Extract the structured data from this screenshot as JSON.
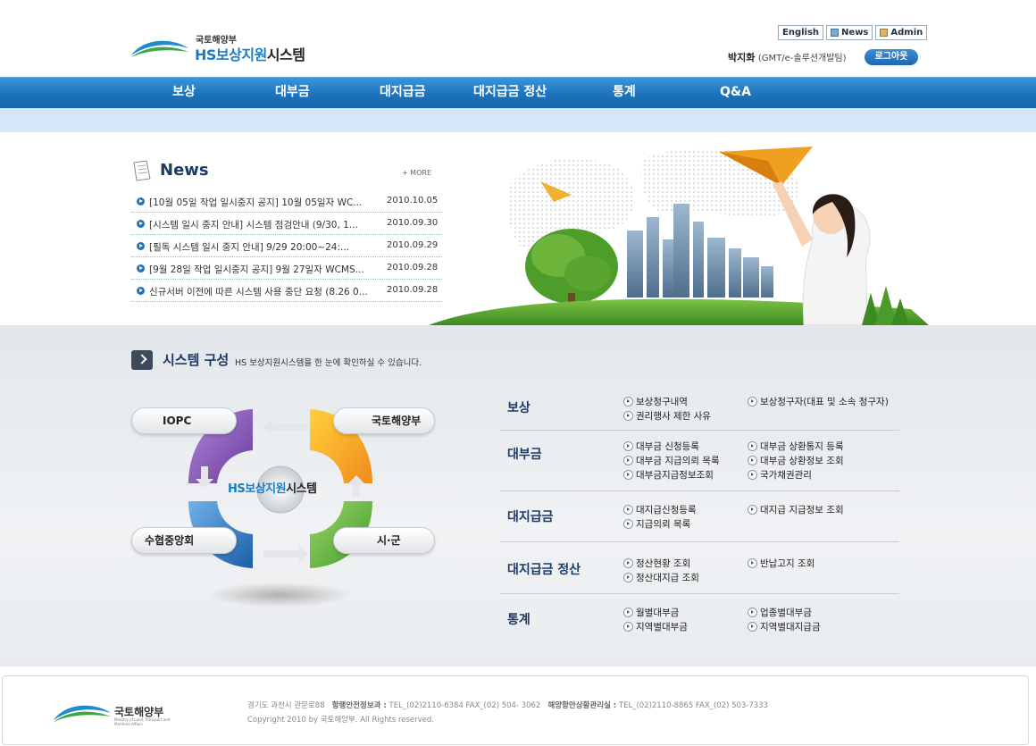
{
  "header": {
    "ministry": "국토해양부",
    "app_title_brand": "HS보상지원",
    "app_title_suffix": "시스템",
    "links": {
      "english": "English",
      "news": "News",
      "admin": "Admin"
    },
    "user_name": "박지화",
    "user_affiliation": "(GMT/e-솔루션개발팀)",
    "logout_label": "로그아웃"
  },
  "nav": {
    "items": [
      {
        "label": "보상"
      },
      {
        "label": "대부금"
      },
      {
        "label": "대지급금"
      },
      {
        "label": "대지급금 정산"
      },
      {
        "label": "통계"
      },
      {
        "label": "Q&A"
      }
    ]
  },
  "news": {
    "title": "News",
    "more": "+ MORE",
    "items": [
      {
        "title": "[10월 05일 작업 일시중지 공지] 10월 05일자 WC...",
        "date": "2010.10.05"
      },
      {
        "title": "[시스템 일시 중지 안내] 시스템 점검안내 (9/30, 1...",
        "date": "2010.09.30"
      },
      {
        "title": "[필독 시스템 일시 중지 안내] 9/29 20:00~24:...",
        "date": "2010.09.29"
      },
      {
        "title": "[9월 28일 작업 일시중지 공지] 9월 27일자 WCMS...",
        "date": "2010.09.28"
      },
      {
        "title": "신규서버 이전에 따른 시스템 사용 중단 요청 (8.26 0...",
        "date": "2010.09.28"
      }
    ]
  },
  "system": {
    "title": "시스템 구성",
    "desc": "HS 보상지원시스템을 한 눈에 확인하실 수 있습니다.",
    "diagram": {
      "center_brand": "HS보상지원",
      "center_suffix": "시스템",
      "nodes": {
        "top_left": "IOPC",
        "top_right": "국토해양부",
        "bottom_left": "수협중앙회",
        "bottom_right": "시·군"
      }
    }
  },
  "menu": {
    "categories": [
      {
        "name": "보상",
        "links": [
          "보상청구내역",
          "보상청구자(대표 및 소속 청구자)",
          "권리행사 제한 사유"
        ]
      },
      {
        "name": "대부금",
        "links": [
          "대부금 신청등록",
          "대부금 상환통지 등록",
          "대부금 지급의뢰 목록",
          "대부금 상환정보 조회",
          "대부금지급정보조회",
          "국가채권관리"
        ]
      },
      {
        "name": "대지급금",
        "links": [
          "대지급신청등록",
          "대지급 지급정보 조회",
          "지급의뢰 목록"
        ]
      },
      {
        "name": "대지급금 정산",
        "links": [
          "정산현황 조회",
          "반납고지 조회",
          "정산대지급 조회"
        ]
      },
      {
        "name": "통계",
        "links": [
          "월별대부금",
          "업종별대부금",
          "지역별대부금",
          "지역별대지급금"
        ]
      }
    ]
  },
  "footer": {
    "ministry": "국토해양부",
    "ministry_en": "Ministry of Land, Transport and Maritime Affairs",
    "address": "경기도 과천시 관문로88",
    "dept1_label": "항행안전정보과 :",
    "dept1_contact": "TEL_(02)2110-6384  FAX_(02) 504- 3062",
    "dept2_label": "해양항만상황관리실 :",
    "dept2_contact": "TEL_(02)2110-8865  FAX_(02) 503-7333",
    "copyright": "Copyright 2010 by 국토해양부. All Rights reserved."
  },
  "colors": {
    "nav_blue": "#1d73bd",
    "brand_blue": "#1b7cc4",
    "heading_navy": "#1e3b66",
    "subnav": "#d4e6f8"
  }
}
